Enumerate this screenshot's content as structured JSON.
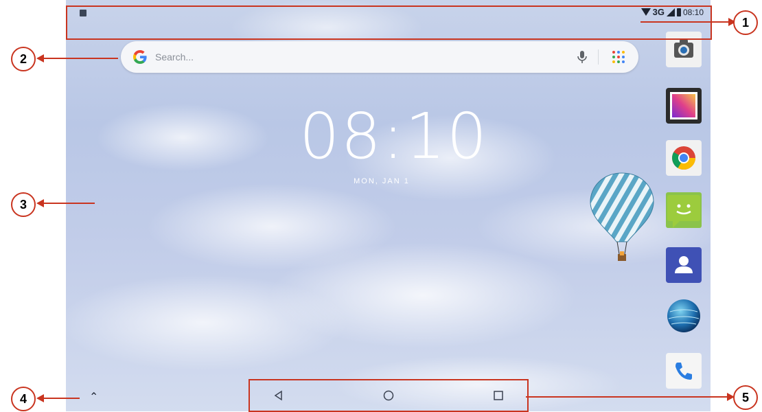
{
  "status_bar": {
    "network": "3G",
    "time": "08:10"
  },
  "search": {
    "placeholder": "Search..."
  },
  "clock": {
    "time": "08:10",
    "date": "MON, JAN 1"
  },
  "dock": {
    "apps": [
      {
        "icon": "camera-icon"
      },
      {
        "icon": "gallery-icon"
      },
      {
        "icon": "chrome-icon"
      },
      {
        "icon": "messaging-icon"
      },
      {
        "icon": "contacts-icon"
      },
      {
        "icon": "browser-globe-icon"
      },
      {
        "icon": "phone-icon"
      }
    ]
  },
  "annotations": {
    "callouts": [
      "1",
      "2",
      "3",
      "4",
      "5"
    ]
  },
  "colors": {
    "annotation_red": "#c9341f",
    "google_blue": "#4285f4",
    "google_red": "#ea4335",
    "google_yellow": "#fbbc05",
    "google_green": "#34a853"
  }
}
